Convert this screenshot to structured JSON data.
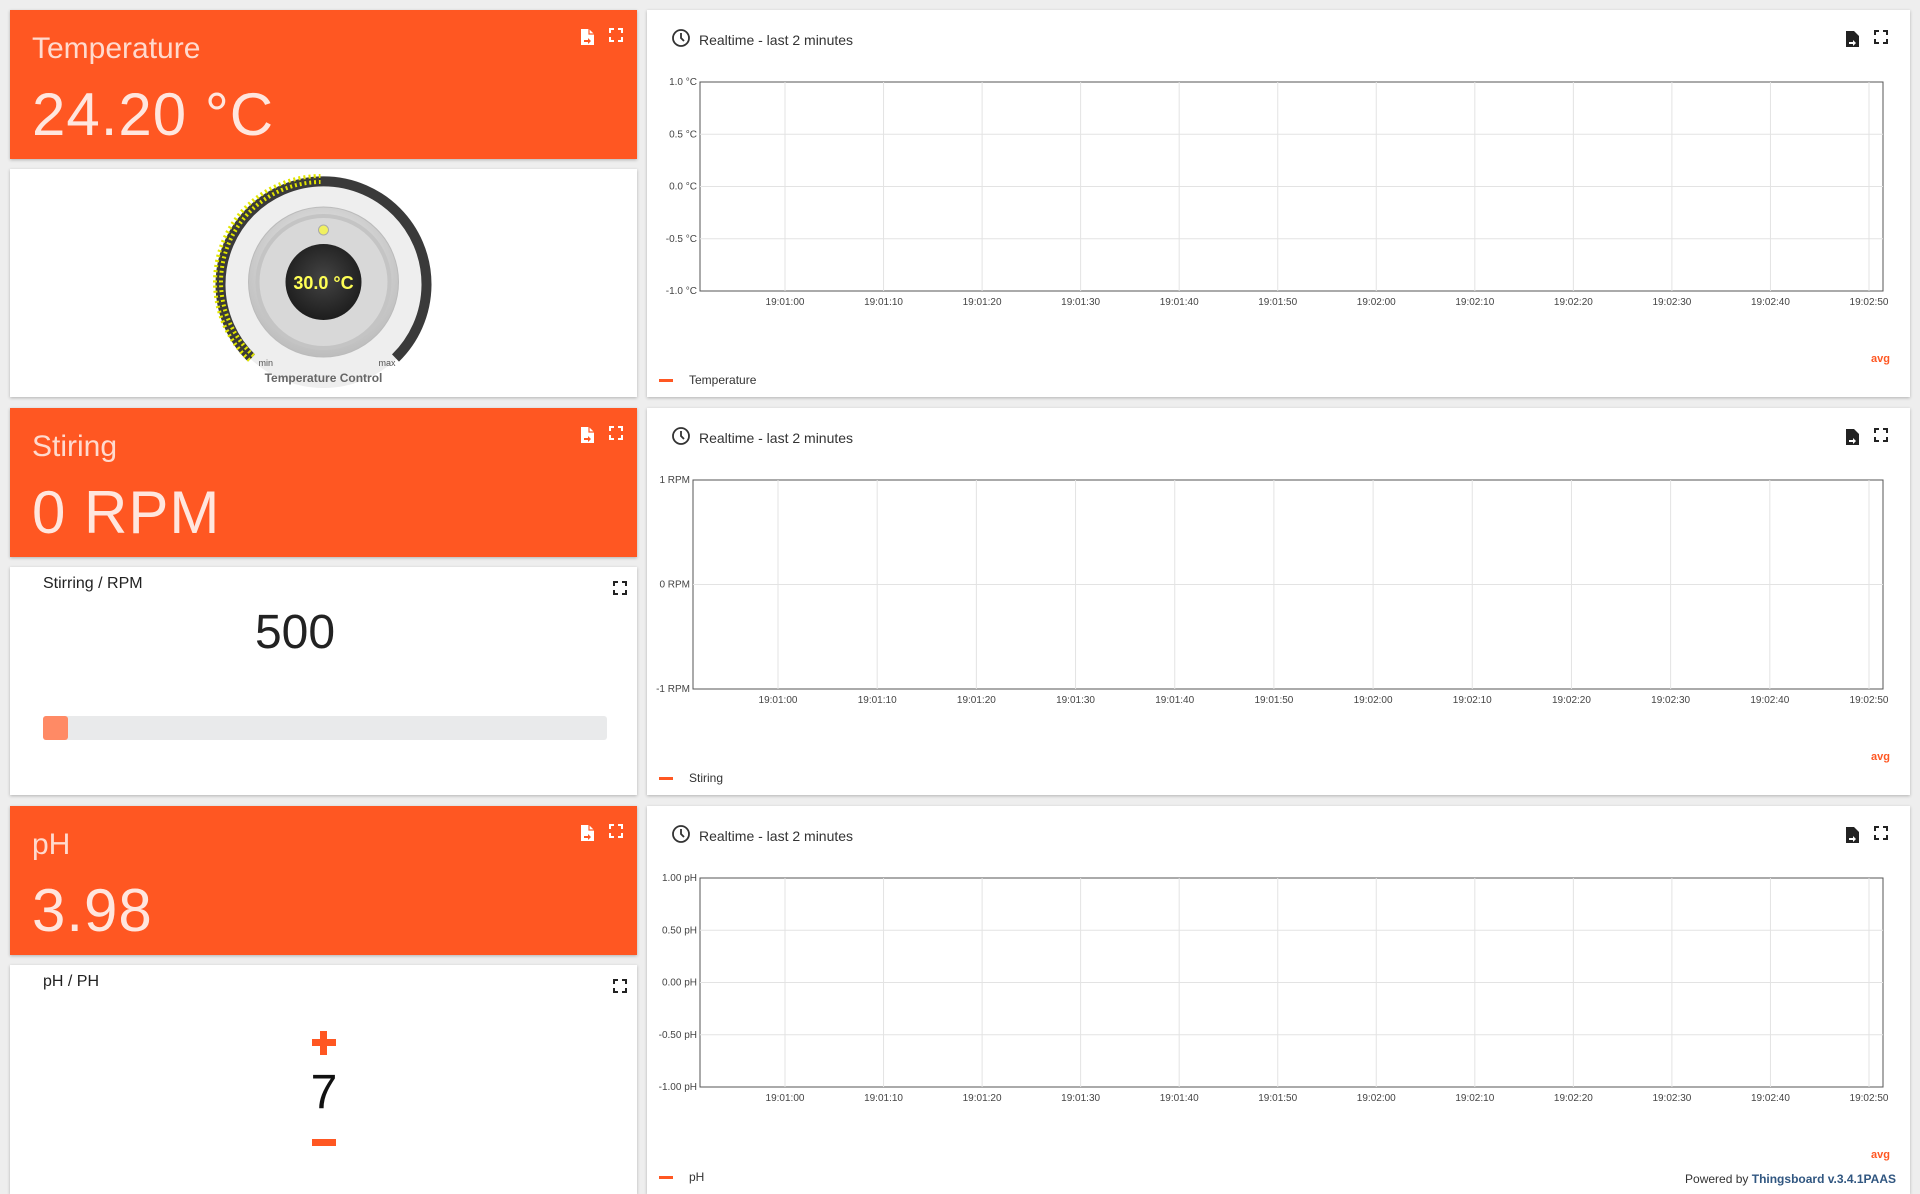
{
  "icon_names": {
    "export": "export-file-icon",
    "fullscreen": "fullscreen-icon",
    "history": "clock-icon"
  },
  "colors": {
    "accent": "#ff5722",
    "gauge_value": "#ffff55",
    "link": "#305680"
  },
  "temperature_card": {
    "title": "Temperature",
    "value": "24.20 °C"
  },
  "temperature_knob": {
    "value_text": "30.0 °C",
    "min_label": "min",
    "max_label": "max",
    "title": "Temperature Control",
    "level": 0.5
  },
  "stiring_card": {
    "title": "Stiring",
    "value": "0 RPM"
  },
  "stirring_slider": {
    "title": "Stirring / RPM",
    "value": "500",
    "fill_fraction": 0.045
  },
  "ph_card": {
    "title": "pH",
    "value": "3.98"
  },
  "ph_stepper": {
    "title": "pH / PH",
    "value": "7"
  },
  "charts": {
    "temperature": {
      "header": "Realtime - last 2 minutes",
      "legend": "Temperature",
      "avg_label": "avg"
    },
    "stiring": {
      "header": "Realtime - last 2 minutes",
      "legend": "Stiring",
      "avg_label": "avg"
    },
    "ph": {
      "header": "Realtime - last 2 minutes",
      "legend": "pH",
      "avg_label": "avg"
    }
  },
  "chart_data": [
    {
      "type": "line",
      "title": "Realtime - last 2 minutes",
      "x_ticks": [
        "19:01:00",
        "19:01:10",
        "19:01:20",
        "19:01:30",
        "19:01:40",
        "19:01:50",
        "19:02:00",
        "19:02:10",
        "19:02:20",
        "19:02:30",
        "19:02:40",
        "19:02:50"
      ],
      "y_ticks": [
        "1.0 °C",
        "0.5 °C",
        "0.0 °C",
        "-0.5 °C",
        "-1.0 °C"
      ],
      "ylim": [
        -1.0,
        1.0
      ],
      "series": [
        {
          "name": "Temperature",
          "values": []
        }
      ],
      "grid": true,
      "legend": "bottom-left"
    },
    {
      "type": "line",
      "title": "Realtime - last 2 minutes",
      "x_ticks": [
        "19:01:00",
        "19:01:10",
        "19:01:20",
        "19:01:30",
        "19:01:40",
        "19:01:50",
        "19:02:00",
        "19:02:10",
        "19:02:20",
        "19:02:30",
        "19:02:40",
        "19:02:50"
      ],
      "y_ticks": [
        "1 RPM",
        "0 RPM",
        "-1 RPM"
      ],
      "ylim": [
        -1,
        1
      ],
      "series": [
        {
          "name": "Stiring",
          "values": []
        }
      ],
      "grid": true,
      "legend": "bottom-left"
    },
    {
      "type": "line",
      "title": "Realtime - last 2 minutes",
      "x_ticks": [
        "19:01:00",
        "19:01:10",
        "19:01:20",
        "19:01:30",
        "19:01:40",
        "19:01:50",
        "19:02:00",
        "19:02:10",
        "19:02:20",
        "19:02:30",
        "19:02:40",
        "19:02:50"
      ],
      "y_ticks": [
        "1.00 pH",
        "0.50 pH",
        "0.00 pH",
        "-0.50 pH",
        "-1.00 pH"
      ],
      "ylim": [
        -1.0,
        1.0
      ],
      "series": [
        {
          "name": "pH",
          "values": []
        }
      ],
      "grid": true,
      "legend": "bottom-left"
    }
  ],
  "footer": {
    "powered_by": "Powered by",
    "link_text": "Thingsboard v.3.4.1PAAS"
  }
}
